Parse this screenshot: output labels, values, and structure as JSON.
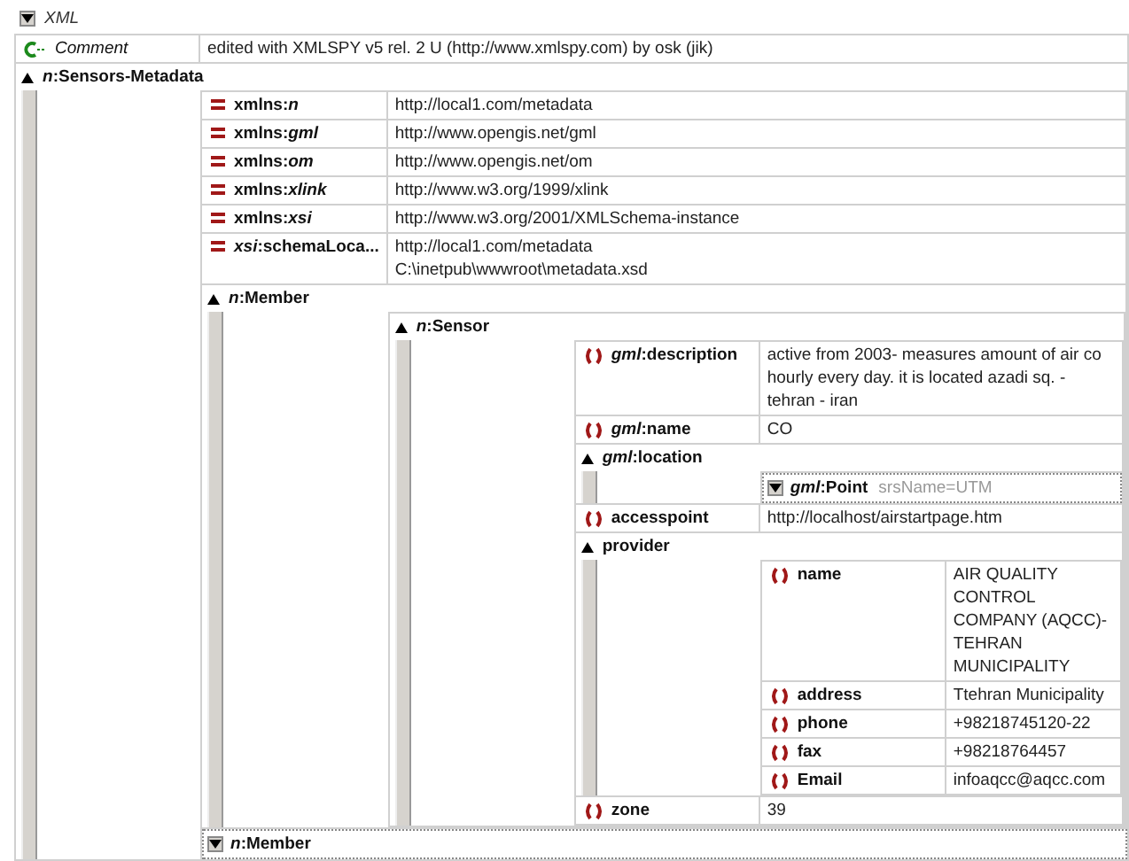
{
  "document": {
    "label": "XML",
    "expanded": true,
    "nodes": [
      {
        "kind": "comment",
        "name": "Comment",
        "value": "edited with XMLSPY v5 rel. 2 U (http://www.xmlspy.com) by osk (jik)"
      },
      {
        "kind": "group",
        "name": "*n*:Sensors-Metadata",
        "expanded": true,
        "children": [
          {
            "kind": "attribute",
            "name": "xmlns:*n*",
            "value": "http://local1.com/metadata"
          },
          {
            "kind": "attribute",
            "name": "xmlns:*gml*",
            "value": "http://www.opengis.net/gml"
          },
          {
            "kind": "attribute",
            "name": "xmlns:*om*",
            "value": "http://www.opengis.net/om"
          },
          {
            "kind": "attribute",
            "name": "xmlns:*xlink*",
            "value": "http://www.w3.org/1999/xlink"
          },
          {
            "kind": "attribute",
            "name": "xmlns:*xsi*",
            "value": "http://www.w3.org/2001/XMLSchema-instance"
          },
          {
            "kind": "attribute",
            "name": "*xsi*:schemaLoca...",
            "value": "http://local1.com/metadata\nC:\\inetpub\\wwwroot\\metadata.xsd"
          },
          {
            "kind": "group",
            "name": "*n*:Member",
            "expanded": true,
            "children": [
              {
                "kind": "group",
                "name": "*n*:Sensor",
                "expanded": true,
                "children": [
                  {
                    "kind": "element",
                    "name": "*gml*:description",
                    "value": "active from 2003- measures amount of air co hourly every day. it is located azadi sq. - tehran - iran"
                  },
                  {
                    "kind": "element",
                    "name": "*gml*:name",
                    "value": "CO"
                  },
                  {
                    "kind": "group",
                    "name": "*gml*:location",
                    "expanded": true,
                    "children": [
                      {
                        "kind": "group",
                        "name": "*gml*:Point",
                        "expanded": false,
                        "attributes": "srsName=UTM"
                      }
                    ]
                  },
                  {
                    "kind": "element",
                    "name": "accesspoint",
                    "value": "http://localhost/airstartpage.htm"
                  },
                  {
                    "kind": "group",
                    "name": "provider",
                    "expanded": true,
                    "children": [
                      {
                        "kind": "element",
                        "name": "name",
                        "value": "AIR QUALITY CONTROL COMPANY (AQCC)-TEHRAN MUNICIPALITY"
                      },
                      {
                        "kind": "element",
                        "name": "address",
                        "value": "Ttehran Municipality"
                      },
                      {
                        "kind": "element",
                        "name": "phone",
                        "value": "+98218745120-22"
                      },
                      {
                        "kind": "element",
                        "name": "fax",
                        "value": "+98218764457"
                      },
                      {
                        "kind": "element",
                        "name": "Email",
                        "value": "infoaqcc@aqcc.com"
                      }
                    ]
                  },
                  {
                    "kind": "element",
                    "name": "zone",
                    "value": "39"
                  }
                ]
              }
            ]
          },
          {
            "kind": "group",
            "name": "*n*:Member",
            "expanded": false
          }
        ]
      }
    ]
  }
}
